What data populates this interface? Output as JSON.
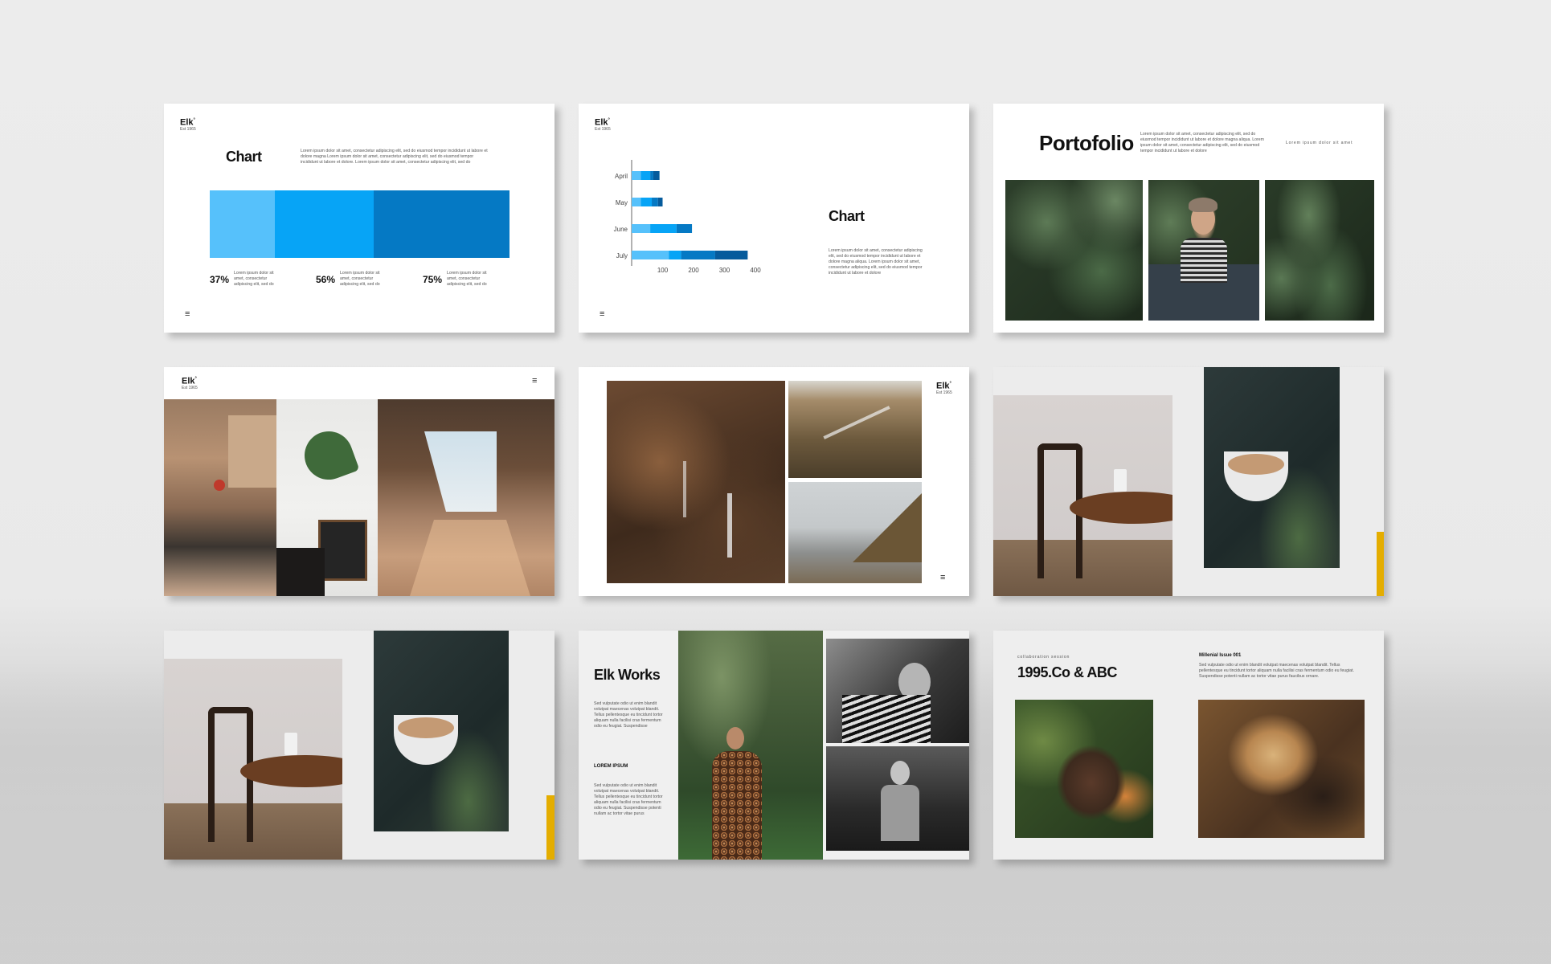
{
  "slide1": {
    "logo": "Elk",
    "logo_sup": "°",
    "logo_sub": "Est 1965",
    "title": "Chart",
    "body": "Lorem ipsum dolor sit amet, consectetur adipiscing elit, sed do eiusmod tempor incididunt ut labore et dolore magna Lorem ipsum dolor sit amet, consectetur adipiscing elit, sed do eiusmod tempor incididunt ut labore et dolore. Lorem ipsum dolor sit amet, consectetur adipiscing elit, sed do",
    "stats": [
      {
        "value": "37%",
        "text": "Lorem ipsum dolor sit amet, consectetur adipiscing elit, sed do"
      },
      {
        "value": "56%",
        "text": "Lorem ipsum dolor sit amet, consectetur adipiscing elit, sed do"
      },
      {
        "value": "75%",
        "text": "Lorem ipsum dolor sit amet, consectetur adipiscing elit, sed do"
      }
    ],
    "bar_colors": [
      "#56c1fb",
      "#07a4f6",
      "#0579c4"
    ]
  },
  "slide2": {
    "logo": "Elk",
    "logo_sup": "°",
    "logo_sub": "Est 1965",
    "title": "Chart",
    "body": "Lorem ipsum dolor sit amet, consectetur adipiscing elit, sed do eiusmod tempor incididunt ut labore et dolore magna aliqua. Lorem ipsum dolor sit amet, consectetur adipiscing elit, sed do eiusmod tempor incididunt ut labore et dolore"
  },
  "chart_data": {
    "type": "bar",
    "orientation": "horizontal",
    "stacked": true,
    "categories": [
      "April",
      "May",
      "June",
      "July"
    ],
    "series": [
      {
        "values": [
          30,
          30,
          60,
          120
        ]
      },
      {
        "values": [
          30,
          35,
          85,
          40
        ]
      },
      {
        "values": [
          10,
          20,
          50,
          110
        ]
      },
      {
        "values": [
          20,
          15,
          0,
          105
        ]
      }
    ],
    "series_colors": [
      "#56c1fb",
      "#07a4f6",
      "#0579c4",
      "#065b9c"
    ],
    "xticks": [
      "100",
      "200",
      "300",
      "400",
      "500"
    ],
    "xlim": [
      0,
      500
    ],
    "legend": "none",
    "grid": false
  },
  "slide3": {
    "title": "Portofolio",
    "body": "Lorem ipsum dolor sit amet, consectetur adipiscing elit, sed do eiusmod tempor incididunt ut labore et dolore magna aliqua. Lorem ipsum dolor sit amet, consectetur adipiscing elit, sed do eiusmod tempor incididunt ut labore et dolore",
    "tag": "Lorem ipsum dolor sit amet"
  },
  "slide4": {
    "logo": "Elk",
    "logo_sup": "°",
    "logo_sub": "Est 1965"
  },
  "slide5": {
    "logo": "Elk",
    "logo_sup": "°",
    "logo_sub": "Est 1965"
  },
  "slide6": {
    "accent": "#e4ad00"
  },
  "slide7": {
    "accent": "#e4ad00"
  },
  "slide8": {
    "title": "Elk Works",
    "body1": "Sed vulputate odio ut enim blandit volutpat maecenas volutpat blandit. Tellus pellentesque eu tincidunt tortor aliquam nulla facilisi cras fermentum odio eu feugiat. Suspendisse",
    "subhead": "LOREM IPSUM",
    "body2": "Sed vulputate odio ut enim blandit volutpat maecenas volutpat blandit. Tellus pellentesque eu tincidunt tortor aliquam nulla facilisi cras fermentum odio eu feugiat. Suspendisse potenti nullam ac tortor vitae purus"
  },
  "slide9": {
    "kicker": "collaboration session",
    "title": "1995.Co & ABC",
    "issue": "Millenial Issue 001",
    "body": "Sed vulputate odio ut enim blandit volutpat maecenas volutpat blandit. Tellus pellentesque eu tincidunt tortor aliquam nulla facilisi cras fermentum odio eu feugiat. Suspendisse potenti nullam ac tortor vitae purus faucibus ornare."
  },
  "menu_icon": "menu-icon"
}
